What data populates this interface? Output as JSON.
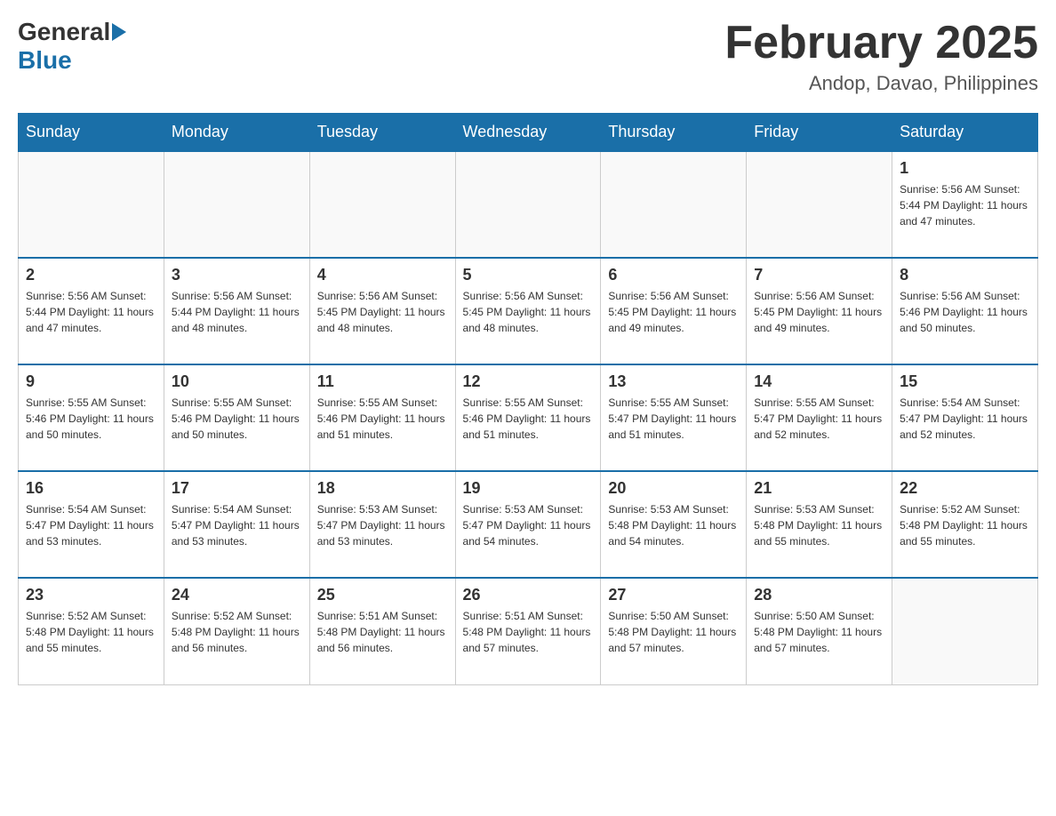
{
  "header": {
    "logo_general": "General",
    "logo_blue": "Blue",
    "month_title": "February 2025",
    "location": "Andop, Davao, Philippines"
  },
  "days_of_week": [
    "Sunday",
    "Monday",
    "Tuesday",
    "Wednesday",
    "Thursday",
    "Friday",
    "Saturday"
  ],
  "weeks": [
    [
      {
        "day": "",
        "info": ""
      },
      {
        "day": "",
        "info": ""
      },
      {
        "day": "",
        "info": ""
      },
      {
        "day": "",
        "info": ""
      },
      {
        "day": "",
        "info": ""
      },
      {
        "day": "",
        "info": ""
      },
      {
        "day": "1",
        "info": "Sunrise: 5:56 AM\nSunset: 5:44 PM\nDaylight: 11 hours\nand 47 minutes."
      }
    ],
    [
      {
        "day": "2",
        "info": "Sunrise: 5:56 AM\nSunset: 5:44 PM\nDaylight: 11 hours\nand 47 minutes."
      },
      {
        "day": "3",
        "info": "Sunrise: 5:56 AM\nSunset: 5:44 PM\nDaylight: 11 hours\nand 48 minutes."
      },
      {
        "day": "4",
        "info": "Sunrise: 5:56 AM\nSunset: 5:45 PM\nDaylight: 11 hours\nand 48 minutes."
      },
      {
        "day": "5",
        "info": "Sunrise: 5:56 AM\nSunset: 5:45 PM\nDaylight: 11 hours\nand 48 minutes."
      },
      {
        "day": "6",
        "info": "Sunrise: 5:56 AM\nSunset: 5:45 PM\nDaylight: 11 hours\nand 49 minutes."
      },
      {
        "day": "7",
        "info": "Sunrise: 5:56 AM\nSunset: 5:45 PM\nDaylight: 11 hours\nand 49 minutes."
      },
      {
        "day": "8",
        "info": "Sunrise: 5:56 AM\nSunset: 5:46 PM\nDaylight: 11 hours\nand 50 minutes."
      }
    ],
    [
      {
        "day": "9",
        "info": "Sunrise: 5:55 AM\nSunset: 5:46 PM\nDaylight: 11 hours\nand 50 minutes."
      },
      {
        "day": "10",
        "info": "Sunrise: 5:55 AM\nSunset: 5:46 PM\nDaylight: 11 hours\nand 50 minutes."
      },
      {
        "day": "11",
        "info": "Sunrise: 5:55 AM\nSunset: 5:46 PM\nDaylight: 11 hours\nand 51 minutes."
      },
      {
        "day": "12",
        "info": "Sunrise: 5:55 AM\nSunset: 5:46 PM\nDaylight: 11 hours\nand 51 minutes."
      },
      {
        "day": "13",
        "info": "Sunrise: 5:55 AM\nSunset: 5:47 PM\nDaylight: 11 hours\nand 51 minutes."
      },
      {
        "day": "14",
        "info": "Sunrise: 5:55 AM\nSunset: 5:47 PM\nDaylight: 11 hours\nand 52 minutes."
      },
      {
        "day": "15",
        "info": "Sunrise: 5:54 AM\nSunset: 5:47 PM\nDaylight: 11 hours\nand 52 minutes."
      }
    ],
    [
      {
        "day": "16",
        "info": "Sunrise: 5:54 AM\nSunset: 5:47 PM\nDaylight: 11 hours\nand 53 minutes."
      },
      {
        "day": "17",
        "info": "Sunrise: 5:54 AM\nSunset: 5:47 PM\nDaylight: 11 hours\nand 53 minutes."
      },
      {
        "day": "18",
        "info": "Sunrise: 5:53 AM\nSunset: 5:47 PM\nDaylight: 11 hours\nand 53 minutes."
      },
      {
        "day": "19",
        "info": "Sunrise: 5:53 AM\nSunset: 5:47 PM\nDaylight: 11 hours\nand 54 minutes."
      },
      {
        "day": "20",
        "info": "Sunrise: 5:53 AM\nSunset: 5:48 PM\nDaylight: 11 hours\nand 54 minutes."
      },
      {
        "day": "21",
        "info": "Sunrise: 5:53 AM\nSunset: 5:48 PM\nDaylight: 11 hours\nand 55 minutes."
      },
      {
        "day": "22",
        "info": "Sunrise: 5:52 AM\nSunset: 5:48 PM\nDaylight: 11 hours\nand 55 minutes."
      }
    ],
    [
      {
        "day": "23",
        "info": "Sunrise: 5:52 AM\nSunset: 5:48 PM\nDaylight: 11 hours\nand 55 minutes."
      },
      {
        "day": "24",
        "info": "Sunrise: 5:52 AM\nSunset: 5:48 PM\nDaylight: 11 hours\nand 56 minutes."
      },
      {
        "day": "25",
        "info": "Sunrise: 5:51 AM\nSunset: 5:48 PM\nDaylight: 11 hours\nand 56 minutes."
      },
      {
        "day": "26",
        "info": "Sunrise: 5:51 AM\nSunset: 5:48 PM\nDaylight: 11 hours\nand 57 minutes."
      },
      {
        "day": "27",
        "info": "Sunrise: 5:50 AM\nSunset: 5:48 PM\nDaylight: 11 hours\nand 57 minutes."
      },
      {
        "day": "28",
        "info": "Sunrise: 5:50 AM\nSunset: 5:48 PM\nDaylight: 11 hours\nand 57 minutes."
      },
      {
        "day": "",
        "info": ""
      }
    ]
  ]
}
